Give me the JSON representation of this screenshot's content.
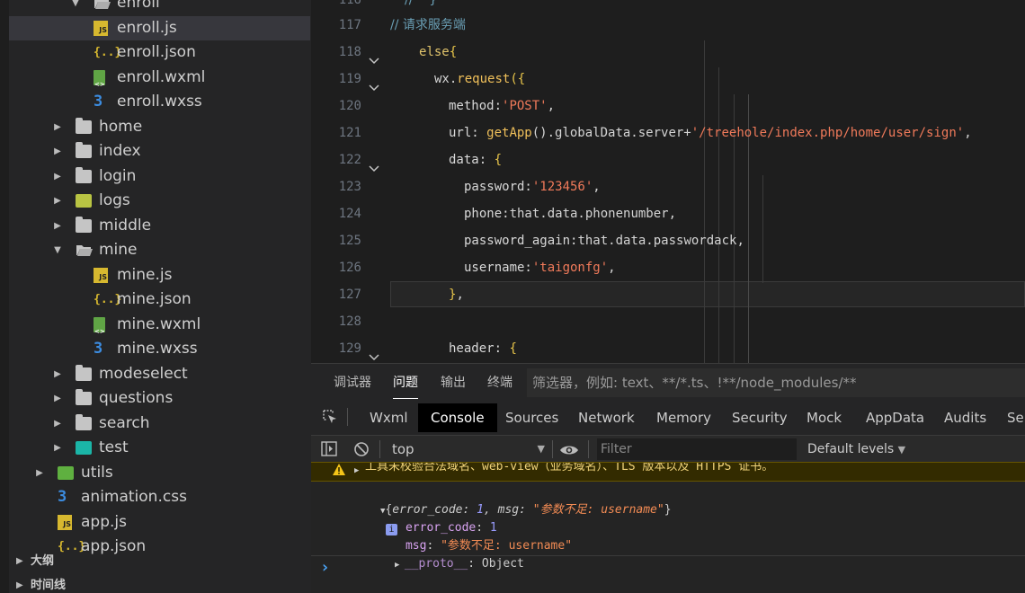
{
  "explorer": {
    "items": [
      {
        "label": "enroll",
        "type": "folder-open"
      },
      {
        "label": "enroll.js",
        "type": "js",
        "selected": true
      },
      {
        "label": "enroll.json",
        "type": "json"
      },
      {
        "label": "enroll.wxml",
        "type": "wxml"
      },
      {
        "label": "enroll.wxss",
        "type": "wxss"
      },
      {
        "label": "home",
        "type": "folder"
      },
      {
        "label": "index",
        "type": "folder"
      },
      {
        "label": "login",
        "type": "folder"
      },
      {
        "label": "logs",
        "type": "logs"
      },
      {
        "label": "middle",
        "type": "folder"
      },
      {
        "label": "mine",
        "type": "folder-open"
      },
      {
        "label": "mine.js",
        "type": "js"
      },
      {
        "label": "mine.json",
        "type": "json"
      },
      {
        "label": "mine.wxml",
        "type": "wxml"
      },
      {
        "label": "mine.wxss",
        "type": "wxss"
      },
      {
        "label": "modeselect",
        "type": "folder"
      },
      {
        "label": "questions",
        "type": "folder"
      },
      {
        "label": "search",
        "type": "folder"
      },
      {
        "label": "test",
        "type": "test"
      },
      {
        "label": "utils",
        "type": "utils"
      },
      {
        "label": "animation.css",
        "type": "wxss"
      },
      {
        "label": "app.js",
        "type": "js"
      },
      {
        "label": "app.json",
        "type": "json"
      }
    ],
    "sections": [
      {
        "label": "大纲"
      },
      {
        "label": "时间线"
      }
    ]
  },
  "editor": {
    "top_partial": "//    }",
    "lines": [
      {
        "num": "117",
        "tokens": [
          [
            "comment",
            "// 请求服务端"
          ]
        ]
      },
      {
        "num": "118",
        "tokens": [
          [
            "kw",
            "else"
          ],
          [
            "brace",
            "{"
          ]
        ]
      },
      {
        "num": "119",
        "tokens": [
          [
            "plain",
            "wx."
          ],
          [
            "fn",
            "request"
          ],
          [
            "brace",
            "({"
          ]
        ]
      },
      {
        "num": "120",
        "tokens": [
          [
            "prop",
            "method:"
          ],
          [
            "str",
            "'POST'"
          ],
          [
            "plain",
            ","
          ]
        ]
      },
      {
        "num": "121",
        "tokens": [
          [
            "prop",
            "url: "
          ],
          [
            "fn",
            "getApp"
          ],
          [
            "plain",
            "().globalData.server+"
          ],
          [
            "str",
            "'/treehole/index.php/home/user/sign'"
          ],
          [
            "plain",
            ","
          ]
        ]
      },
      {
        "num": "122",
        "tokens": [
          [
            "prop",
            "data: "
          ],
          [
            "brace",
            "{"
          ]
        ]
      },
      {
        "num": "123",
        "tokens": [
          [
            "prop",
            "password:"
          ],
          [
            "str",
            "'123456'"
          ],
          [
            "plain",
            ","
          ]
        ]
      },
      {
        "num": "124",
        "tokens": [
          [
            "prop",
            "phone:"
          ],
          [
            "plain",
            "that.data.phonenumber,"
          ]
        ]
      },
      {
        "num": "125",
        "tokens": [
          [
            "prop",
            "password_again:"
          ],
          [
            "plain",
            "that.data.passwordack,"
          ]
        ]
      },
      {
        "num": "126",
        "tokens": [
          [
            "prop",
            "username:"
          ],
          [
            "str",
            "'taigonfg'"
          ],
          [
            "plain",
            ","
          ]
        ]
      },
      {
        "num": "127",
        "tokens": [
          [
            "brace",
            "}"
          ],
          [
            "plain",
            ","
          ]
        ]
      },
      {
        "num": "128",
        "tokens": []
      },
      {
        "num": "129",
        "tokens": [
          [
            "prop",
            "header: "
          ],
          [
            "brace",
            "{"
          ]
        ]
      }
    ]
  },
  "panel": {
    "tabs": [
      "调试器",
      "问题",
      "输出",
      "终端"
    ],
    "active_tab": "问题",
    "filter_placeholder": "筛选器，例如: text、**/*.ts、!**/node_modules/**"
  },
  "devtools": {
    "tabs": [
      "Wxml",
      "Console",
      "Sources",
      "Network",
      "Memory",
      "Security",
      "Mock",
      "AppData",
      "Audits",
      "Sensor"
    ],
    "active_tab": "Console",
    "context": "top",
    "filter_placeholder": "Filter",
    "levels": "Default levels"
  },
  "console": {
    "warning": "工具未校验合法域名、web-view（业务域名）、TLS 版本以及 HTTPS 证书。",
    "object_summary_open": "{",
    "object_summary_close": "}",
    "summary_key1": "error_code",
    "summary_val1": "1",
    "summary_key2": "msg",
    "summary_val2": "\"参数不足: username\"",
    "prop1_key": "error_code",
    "prop1_val": "1",
    "prop2_key": "msg",
    "prop2_val": "\"参数不足: username\"",
    "proto_key": "__proto__",
    "proto_val": "Object",
    "info_badge": "i",
    "prompt": "›"
  }
}
